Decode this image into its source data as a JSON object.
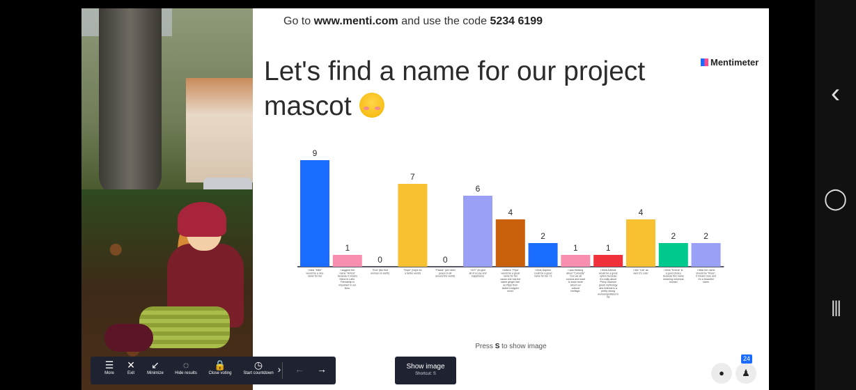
{
  "slide": {
    "join_prefix": "Go to ",
    "join_url": "www.menti.com",
    "join_middle": " and use the code ",
    "join_code": "5234 6199",
    "title": "Let's find a name for our project mascot",
    "logo": "Mentimeter",
    "press_prefix": "Press ",
    "press_key": "S",
    "press_suffix": " to show image"
  },
  "chart_data": {
    "type": "bar",
    "categories": [
      "I think \"Mille\" would be a nice name for her",
      "I suggest the name \"Amiza\" because it means friend in Latin. Friendship is important in our lives.",
      "\"Eva\" (the first woman on earth)",
      "\"Hope\" (hope for a better world)",
      "\"Pacea\" (we need peace in all around the world)",
      "\"JOY\" (to give all of us joy and happiness)",
      "I believe \"Pipa\" would be a great name for her cause she has the same ginger hair as Pippi from Astrid Lindgren novel.",
      "I think Daphne could be a good name for her <3",
      "I was thinking about \"Curiosity\" 'Cos we all curious and want to learn more about our cultural heritage.",
      "I think Artemis would be a great option because it's really about Percy Jackson greek mythology and Artemis is a pretty strong woman/goddess to me",
      "I like \"Lila\" as well, it's cute!",
      "I think \"Emma\" is a good choice because this name meaning universal woman",
      "I think her name should be \"Rose\", it means rose and it's a beautiful name"
    ],
    "values": [
      9,
      1,
      0,
      7,
      0,
      6,
      4,
      2,
      1,
      1,
      4,
      2,
      2
    ],
    "colors": [
      "#196cff",
      "#f98fb0",
      "#f5c22f",
      "#f8c132",
      "#f8c132",
      "#9aa0f5",
      "#c8600c",
      "#196cff",
      "#f98fb0",
      "#f0303a",
      "#f8c132",
      "#00c98d",
      "#9aa0f5"
    ],
    "ylim": [
      0,
      9
    ]
  },
  "toolbar": {
    "items": [
      {
        "icon": "☰",
        "label": "More"
      },
      {
        "icon": "✕",
        "label": "Exit"
      },
      {
        "icon": "↙",
        "label": "Minimize"
      },
      {
        "icon": "◌",
        "label": "Hide results"
      },
      {
        "icon": "🔒",
        "label": "Close voting"
      },
      {
        "icon": "◷",
        "label": "Start countdown"
      }
    ],
    "more_arrow": "›",
    "prev_arrow": "←",
    "next_arrow": "→"
  },
  "show_image": {
    "label": "Show image",
    "shortcut": "Shortcut: S"
  },
  "participants": {
    "count": "24"
  },
  "android_nav": {
    "back": "‹",
    "home": "◯",
    "recents": "|||"
  }
}
